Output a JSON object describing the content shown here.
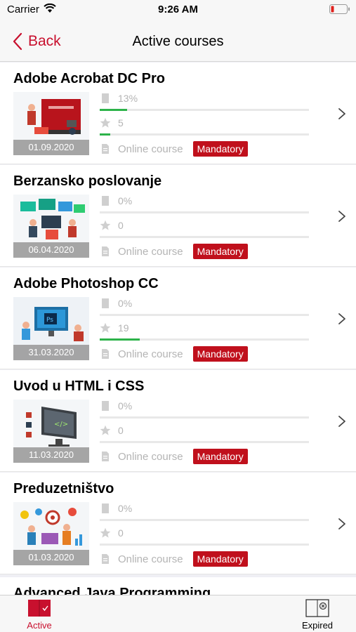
{
  "status_bar": {
    "carrier": "Carrier",
    "time": "9:26 AM"
  },
  "nav": {
    "back_label": "Back",
    "title": "Active courses"
  },
  "courses": [
    {
      "title": "Adobe Acrobat DC Pro",
      "date": "01.09.2020",
      "progress": "13%",
      "progress_fraction": 0.13,
      "score": "5",
      "score_fraction": 0.05,
      "type": "Online course",
      "badge": "Mandatory"
    },
    {
      "title": "Berzansko poslovanje",
      "date": "06.04.2020",
      "progress": "0%",
      "progress_fraction": 0,
      "score": "0",
      "score_fraction": 0,
      "type": "Online course",
      "badge": "Mandatory"
    },
    {
      "title": "Adobe Photoshop CC",
      "date": "31.03.2020",
      "progress": "0%",
      "progress_fraction": 0,
      "score": "19",
      "score_fraction": 0.19,
      "type": "Online course",
      "badge": "Mandatory"
    },
    {
      "title": "Uvod u HTML i CSS",
      "date": "11.03.2020",
      "progress": "0%",
      "progress_fraction": 0,
      "score": "0",
      "score_fraction": 0,
      "type": "Online course",
      "badge": "Mandatory"
    },
    {
      "title": "Preduzetništvo",
      "date": "01.03.2020",
      "progress": "0%",
      "progress_fraction": 0,
      "score": "0",
      "score_fraction": 0,
      "type": "Online course",
      "badge": "Mandatory"
    }
  ],
  "partial_course_title": "Advanced Java Programming",
  "tabs": {
    "active_label": "Active",
    "expired_label": "Expired"
  },
  "colors": {
    "accent": "#c8102e",
    "badge": "#c0101c",
    "progress": "#2db34a"
  }
}
